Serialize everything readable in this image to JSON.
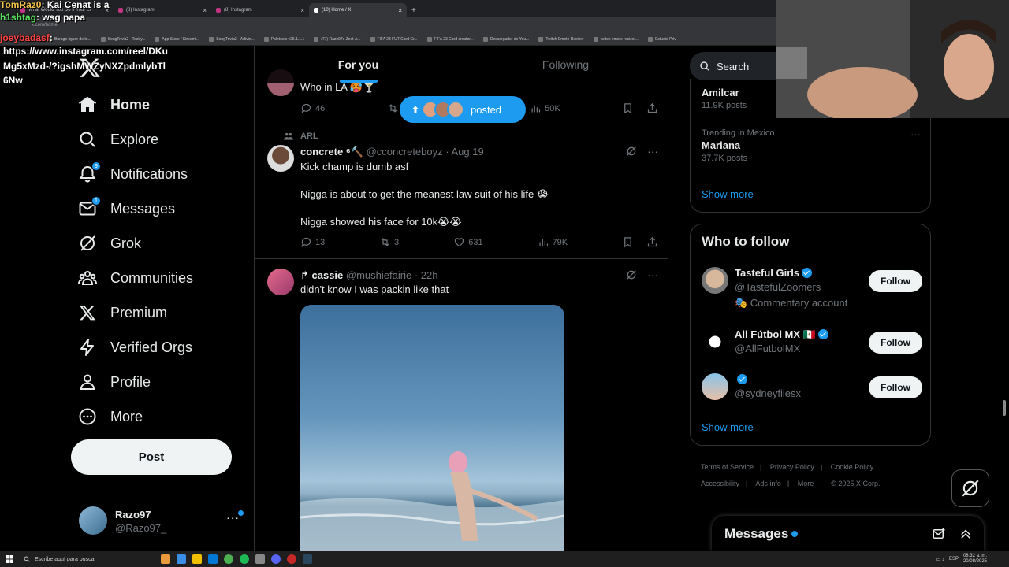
{
  "browser": {
    "tabs": [
      {
        "label": "What Would You Do If Your Et",
        "active": false
      },
      {
        "label": "(8) Instagram",
        "active": false
      },
      {
        "label": "(8) Instagram",
        "active": false
      },
      {
        "label": "(10) Home / X",
        "active": true
      }
    ],
    "url": "x.com/home",
    "bookmarks": [
      "Burago figure de to...",
      "SongTrivia2 - Test y...",
      "App Store / Streami...",
      "SongTrivia2 - Adivin...",
      "Paletools v25.1.1.1",
      "(77) Razo97s Zest-A...",
      "FIFA 23 FUT Card Cr...",
      "FIFA 23 Card creator...",
      "Descargador de You...",
      "Twitch Emote Resizer",
      "twitch emote resizer...",
      "Estudio Priv"
    ]
  },
  "chat_overlay": {
    "lines": [
      {
        "user": "TomRaz0",
        "text": ": Kai Cenat is a"
      },
      {
        "user": "h1shtag",
        "text": ": wsg papa"
      },
      {
        "user": "joeybadasf",
        "text": ":"
      }
    ],
    "url_text": "https://www.instagram.com/reel/DKuMg5xMzd-/?igshMWZyNXZpdmlybTl6Nw"
  },
  "nav": {
    "items": [
      {
        "label": "Home",
        "icon": "home-icon",
        "active": true,
        "badge": ""
      },
      {
        "label": "Explore",
        "icon": "search-icon",
        "active": false,
        "badge": ""
      },
      {
        "label": "Notifications",
        "icon": "bell-icon",
        "active": false,
        "badge": "9"
      },
      {
        "label": "Messages",
        "icon": "envelope-icon",
        "active": false,
        "badge": "1"
      },
      {
        "label": "Grok",
        "icon": "grok-icon",
        "active": false,
        "badge": ""
      },
      {
        "label": "Communities",
        "icon": "people-icon",
        "active": false,
        "badge": ""
      },
      {
        "label": "Premium",
        "icon": "x-logo-icon",
        "active": false,
        "badge": ""
      },
      {
        "label": "Verified Orgs",
        "icon": "lightning-icon",
        "active": false,
        "badge": ""
      },
      {
        "label": "Profile",
        "icon": "person-icon",
        "active": false,
        "badge": ""
      },
      {
        "label": "More",
        "icon": "more-circle-icon",
        "active": false,
        "badge": ""
      }
    ],
    "post_label": "Post",
    "account": {
      "name": "Razo97",
      "handle": "@Razo97_"
    }
  },
  "timeline": {
    "tabs": [
      {
        "label": "For you",
        "active": true
      },
      {
        "label": "Following",
        "active": false
      }
    ],
    "posted_pill": "posted",
    "tweets": [
      {
        "text": "Who in LA 🥵🍸",
        "replies": "46",
        "retweets": "6",
        "likes": "",
        "views": "50K"
      },
      {
        "context": "ARL",
        "name": "concrete ⁶🔨",
        "handle": "@cconcreteboyz",
        "time": "Aug 19",
        "lines": [
          "Kick champ is dumb asf",
          "Nigga is about to get the meanest law suit of his life 😭",
          "Nigga showed his face for 10k😭😭"
        ],
        "replies": "13",
        "retweets": "3",
        "likes": "631",
        "views": "79K"
      },
      {
        "name": "↱ cassie",
        "handle": "@mushiefairie",
        "time": "22h",
        "text": "didn't know I was packin like that"
      }
    ]
  },
  "right": {
    "search_placeholder": "Search",
    "trends": [
      {
        "category": "",
        "name": "Amilcar",
        "count": "11.9K posts"
      },
      {
        "category": "Trending in Mexico",
        "name": "Mariana",
        "count": "37.7K posts"
      }
    ],
    "show_more": "Show more",
    "who_to_follow": {
      "title": "Who to follow",
      "accounts": [
        {
          "name": "Tasteful Girls",
          "handle": "@TastefulZoomers",
          "sub": "🎭 Commentary account",
          "verified": true
        },
        {
          "name": "All Fútbol MX 🇲🇽",
          "handle": "@AllFutbolMX",
          "sub": "",
          "verified": true
        },
        {
          "name": "",
          "handle": "@sydneyfilesx",
          "sub": "",
          "verified": true
        }
      ],
      "follow_label": "Follow",
      "show_more": "Show more"
    },
    "footer": [
      "Terms of Service",
      "|",
      "Privacy Policy",
      "|",
      "Cookie Policy",
      "|",
      "Accessibility",
      "|",
      "Ads info",
      "|",
      "More ···",
      "© 2025 X Corp."
    ]
  },
  "messages_dock": {
    "label": "Messages"
  },
  "taskbar": {
    "search_placeholder": "Escribe aquí para buscar",
    "time": "08:32 a. m.",
    "date": "20/08/2025",
    "lang": "ESP"
  },
  "colors": {
    "accent": "#1d9bf0",
    "bg": "#000000",
    "text": "#e7e9ea",
    "muted": "#71767b",
    "border": "#2f3336"
  }
}
